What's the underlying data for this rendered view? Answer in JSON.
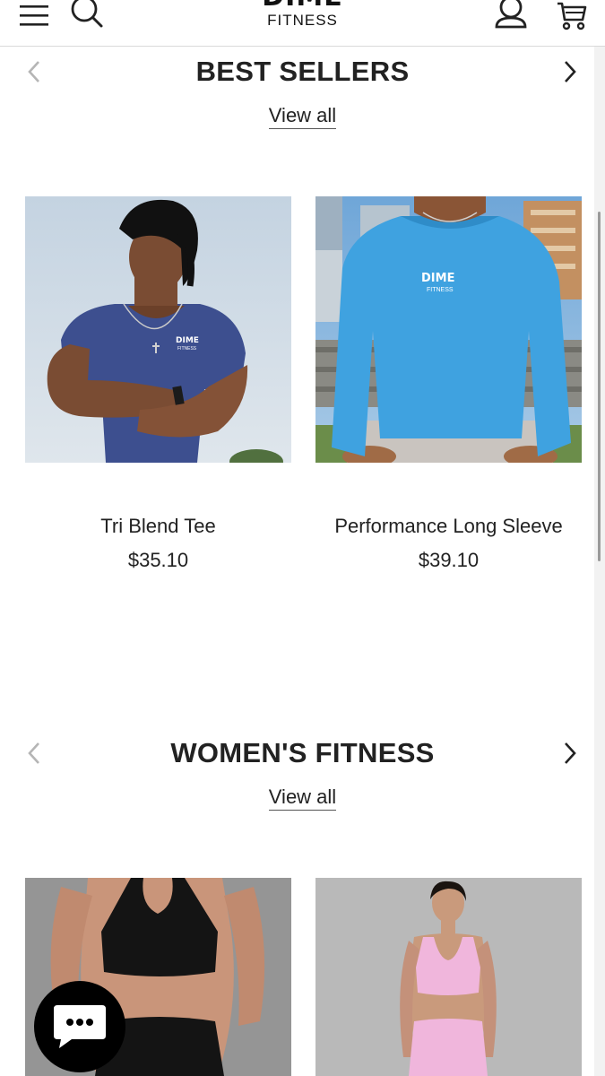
{
  "header": {
    "logo_main": "DIME",
    "logo_sub": "FITNESS",
    "icons": [
      "menu-icon",
      "search-icon",
      "account-icon",
      "cart-icon"
    ]
  },
  "sections": [
    {
      "title": "BEST SELLERS",
      "view_all": "View all",
      "products": [
        {
          "title": "Tri Blend Tee",
          "price": "$35.10",
          "shirt_print": "DIME",
          "shirt_print_sub": "FITNESS"
        },
        {
          "title": "Performance Long Sleeve",
          "price": "$39.10",
          "shirt_print": "DIME",
          "shirt_print_sub": "FITNESS"
        }
      ]
    },
    {
      "title": "WOMEN'S FITNESS",
      "view_all": "View all",
      "products": []
    }
  ],
  "colors": {
    "navy_tee": "#3d4f8f",
    "light_blue_sleeve": "#3fa2e0",
    "pink_set": "#f0b6dc",
    "black_set": "#141414"
  },
  "chat": {
    "icon": "chat-bubble-icon"
  }
}
